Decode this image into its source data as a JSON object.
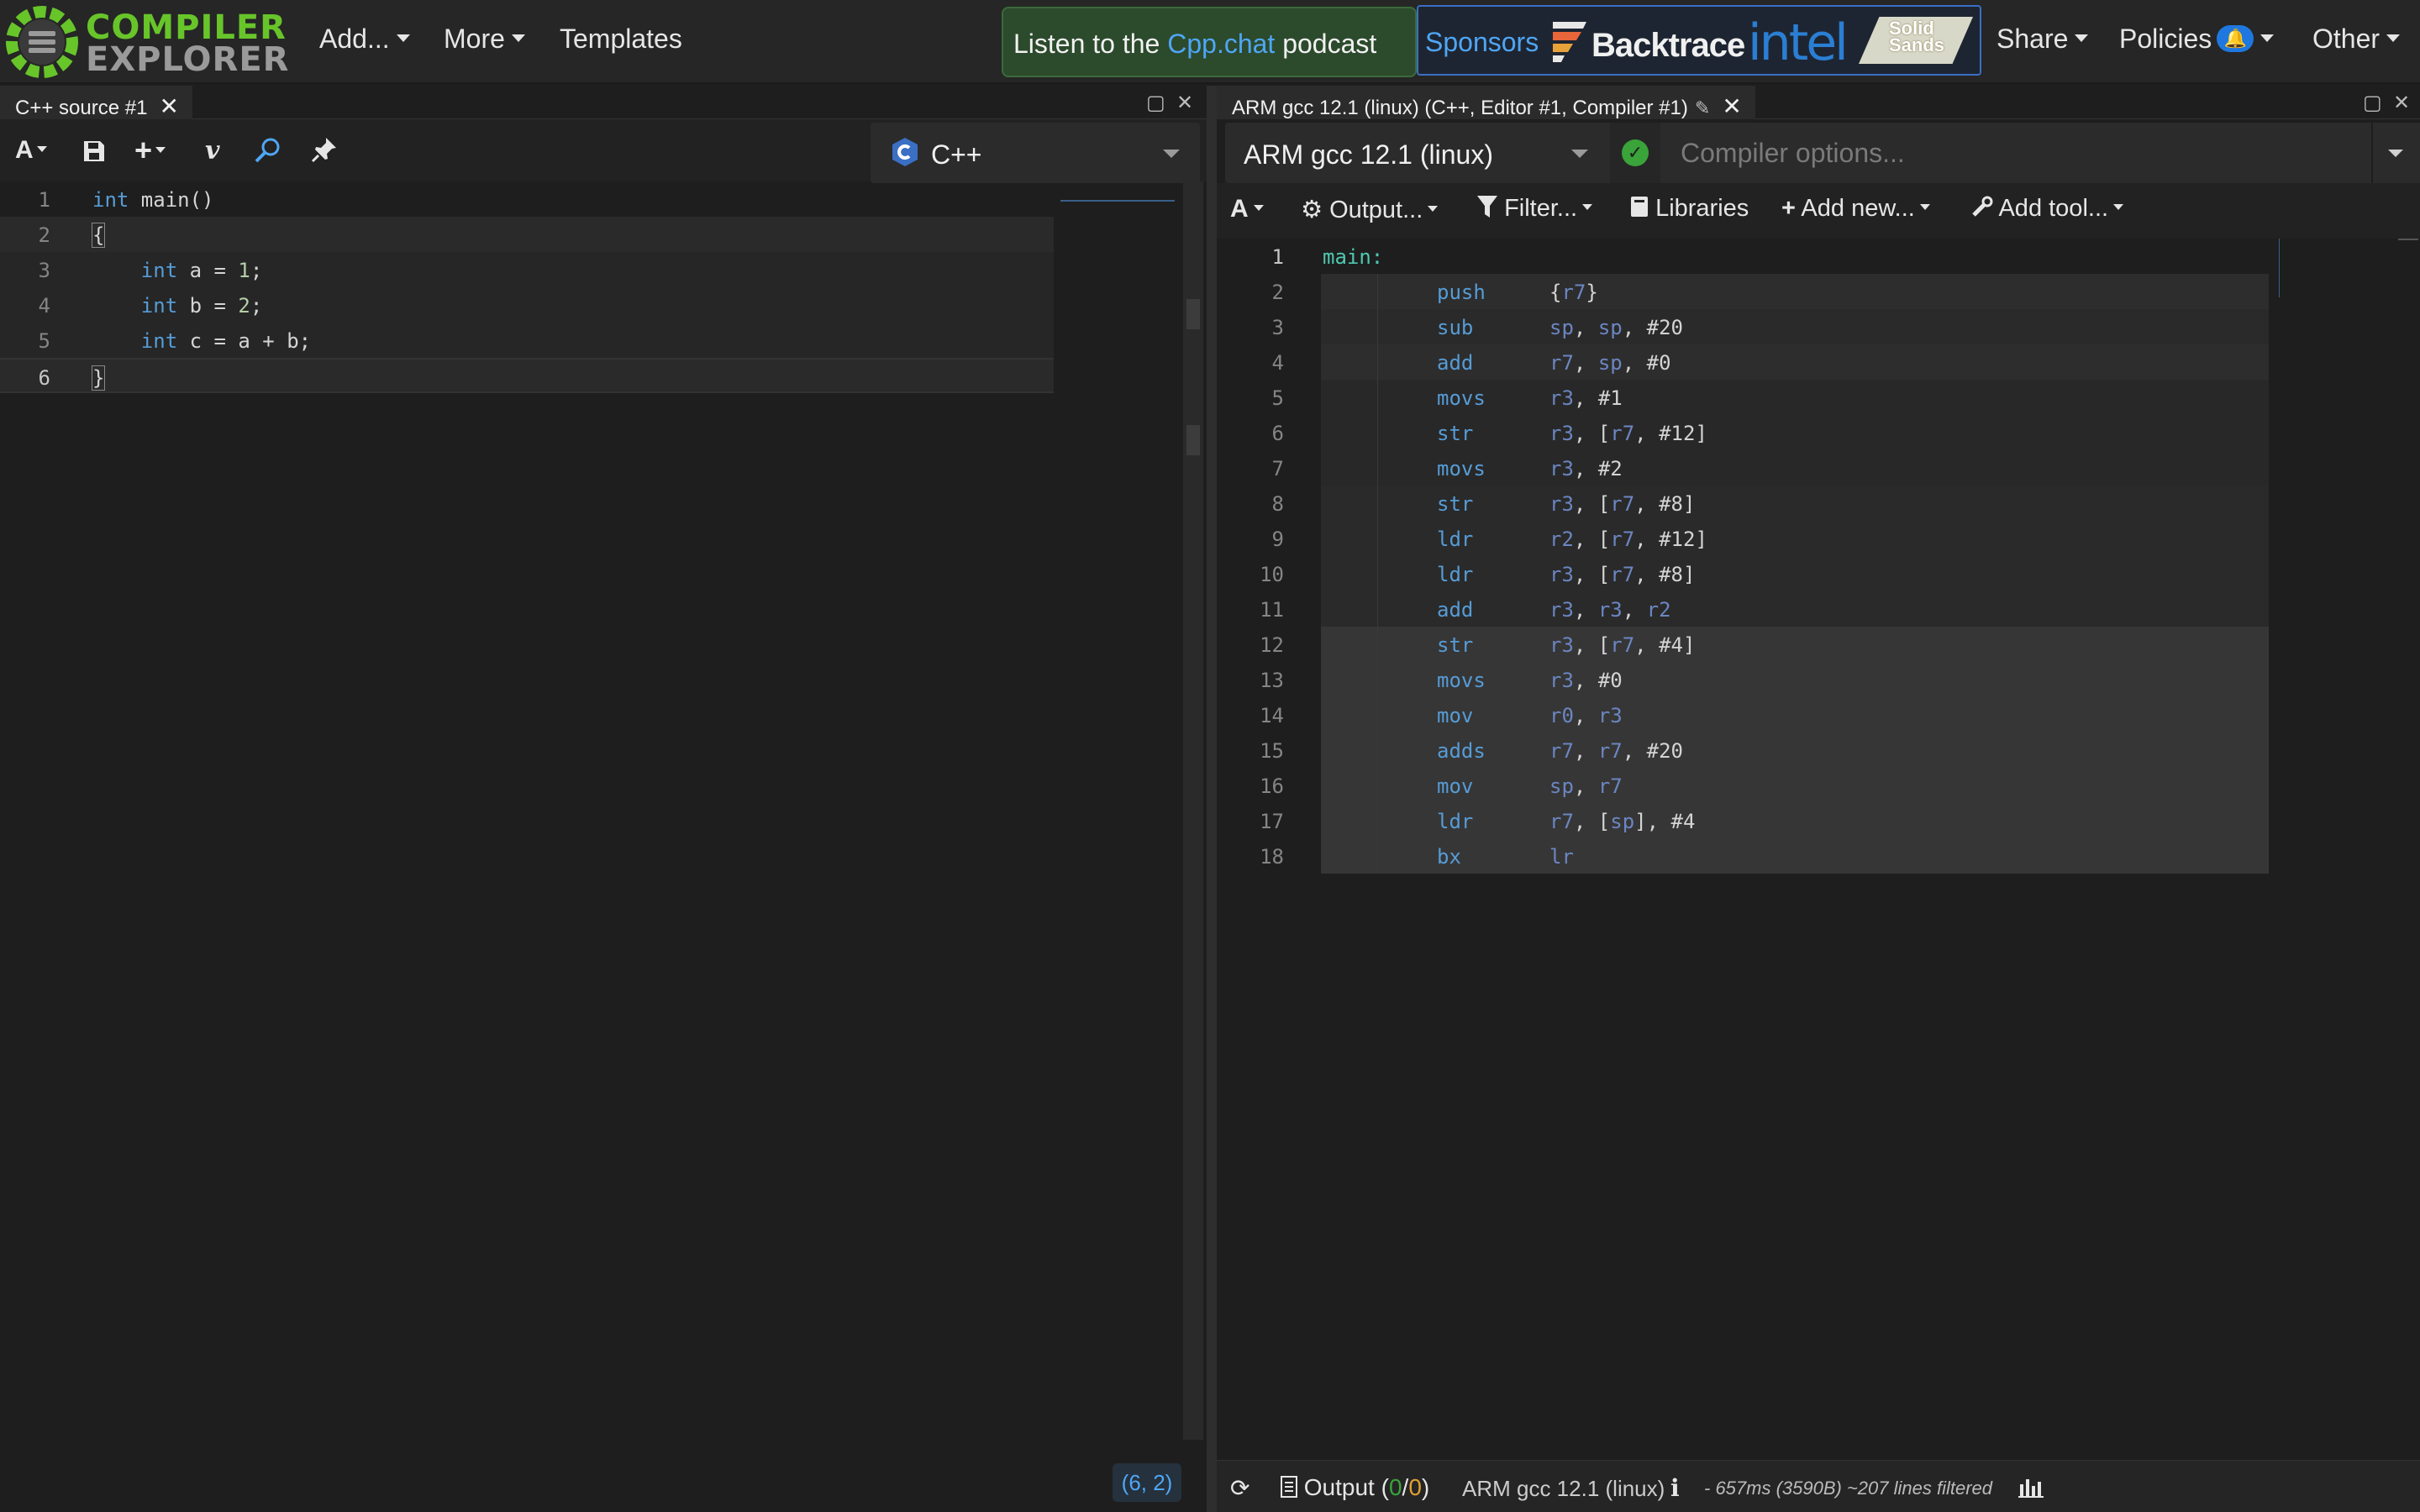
{
  "app": {
    "logo_line1": "COMPILER",
    "logo_line2": "EXPLORER"
  },
  "nav": {
    "add_label": "Add...",
    "more_label": "More",
    "templates_label": "Templates",
    "podcast_prefix": "Listen to the ",
    "podcast_link": "Cpp.chat",
    "podcast_suffix": " podcast",
    "sponsors_label": "Sponsors",
    "sponsor_1": "Backtrace",
    "sponsor_2": "intel",
    "sponsor_3_line1": "Solid",
    "sponsor_3_line2": "Sands",
    "share_label": "Share",
    "policies_label": "Policies",
    "other_label": "Other"
  },
  "source_pane": {
    "tab_title": "C++ source #1",
    "language": "C++",
    "cursor_position": "(6, 2)",
    "lines": [
      {
        "n": "1",
        "indent": "",
        "kw": "int",
        "rest": " main()"
      },
      {
        "n": "2",
        "indent": "",
        "kw": "",
        "rest": "{"
      },
      {
        "n": "3",
        "indent": "    ",
        "kw": "int",
        "rest": " a = ",
        "num": "1",
        "end": ";"
      },
      {
        "n": "4",
        "indent": "    ",
        "kw": "int",
        "rest": " b = ",
        "num": "2",
        "end": ";"
      },
      {
        "n": "5",
        "indent": "    ",
        "kw": "int",
        "rest": " c = a + b;"
      },
      {
        "n": "6",
        "indent": "",
        "kw": "",
        "rest": "}"
      }
    ]
  },
  "compiler_pane": {
    "tab_title": "ARM gcc 12.1 (linux) (C++, Editor #1, Compiler #1)",
    "compiler": "ARM gcc 12.1 (linux)",
    "options_placeholder": "Compiler options...",
    "toolbar": {
      "output": "Output...",
      "filter": "Filter...",
      "libraries": "Libraries",
      "add_new": "Add new...",
      "add_tool": "Add tool..."
    },
    "label": "main:",
    "asm": [
      {
        "n": "2",
        "op": "push",
        "args": [
          [
            "p",
            "{"
          ],
          [
            "r",
            "r7"
          ],
          [
            "p",
            "}"
          ]
        ]
      },
      {
        "n": "3",
        "op": "sub",
        "args": [
          [
            "r",
            "sp"
          ],
          [
            "p",
            ", "
          ],
          [
            "r",
            "sp"
          ],
          [
            "p",
            ", "
          ],
          [
            "i",
            "#20"
          ]
        ]
      },
      {
        "n": "4",
        "op": "add",
        "args": [
          [
            "r",
            "r7"
          ],
          [
            "p",
            ", "
          ],
          [
            "r",
            "sp"
          ],
          [
            "p",
            ", "
          ],
          [
            "i",
            "#0"
          ]
        ]
      },
      {
        "n": "5",
        "op": "movs",
        "args": [
          [
            "r",
            "r3"
          ],
          [
            "p",
            ", "
          ],
          [
            "i",
            "#1"
          ]
        ]
      },
      {
        "n": "6",
        "op": "str",
        "args": [
          [
            "r",
            "r3"
          ],
          [
            "p",
            ", ["
          ],
          [
            "r",
            "r7"
          ],
          [
            "p",
            ", "
          ],
          [
            "i",
            "#12"
          ],
          [
            "p",
            "]"
          ]
        ]
      },
      {
        "n": "7",
        "op": "movs",
        "args": [
          [
            "r",
            "r3"
          ],
          [
            "p",
            ", "
          ],
          [
            "i",
            "#2"
          ]
        ]
      },
      {
        "n": "8",
        "op": "str",
        "args": [
          [
            "r",
            "r3"
          ],
          [
            "p",
            ", ["
          ],
          [
            "r",
            "r7"
          ],
          [
            "p",
            ", "
          ],
          [
            "i",
            "#8"
          ],
          [
            "p",
            "]"
          ]
        ]
      },
      {
        "n": "9",
        "op": "ldr",
        "args": [
          [
            "r",
            "r2"
          ],
          [
            "p",
            ", ["
          ],
          [
            "r",
            "r7"
          ],
          [
            "p",
            ", "
          ],
          [
            "i",
            "#12"
          ],
          [
            "p",
            "]"
          ]
        ]
      },
      {
        "n": "10",
        "op": "ldr",
        "args": [
          [
            "r",
            "r3"
          ],
          [
            "p",
            ", ["
          ],
          [
            "r",
            "r7"
          ],
          [
            "p",
            ", "
          ],
          [
            "i",
            "#8"
          ],
          [
            "p",
            "]"
          ]
        ]
      },
      {
        "n": "11",
        "op": "add",
        "args": [
          [
            "r",
            "r3"
          ],
          [
            "p",
            ", "
          ],
          [
            "r",
            "r3"
          ],
          [
            "p",
            ", "
          ],
          [
            "r",
            "r2"
          ]
        ]
      },
      {
        "n": "12",
        "op": "str",
        "args": [
          [
            "r",
            "r3"
          ],
          [
            "p",
            ", ["
          ],
          [
            "r",
            "r7"
          ],
          [
            "p",
            ", "
          ],
          [
            "i",
            "#4"
          ],
          [
            "p",
            "]"
          ]
        ]
      },
      {
        "n": "13",
        "op": "movs",
        "args": [
          [
            "r",
            "r3"
          ],
          [
            "p",
            ", "
          ],
          [
            "i",
            "#0"
          ]
        ]
      },
      {
        "n": "14",
        "op": "mov",
        "args": [
          [
            "r",
            "r0"
          ],
          [
            "p",
            ", "
          ],
          [
            "r",
            "r3"
          ]
        ]
      },
      {
        "n": "15",
        "op": "adds",
        "args": [
          [
            "r",
            "r7"
          ],
          [
            "p",
            ", "
          ],
          [
            "r",
            "r7"
          ],
          [
            "p",
            ", "
          ],
          [
            "i",
            "#20"
          ]
        ]
      },
      {
        "n": "16",
        "op": "mov",
        "args": [
          [
            "r",
            "sp"
          ],
          [
            "p",
            ", "
          ],
          [
            "r",
            "r7"
          ]
        ]
      },
      {
        "n": "17",
        "op": "ldr",
        "args": [
          [
            "r",
            "r7"
          ],
          [
            "p",
            ", ["
          ],
          [
            "r",
            "sp"
          ],
          [
            "p",
            "], "
          ],
          [
            "i",
            "#4"
          ]
        ]
      },
      {
        "n": "18",
        "op": "bx",
        "args": [
          [
            "r",
            "lr"
          ]
        ]
      }
    ],
    "status": {
      "output_label": "Output (",
      "output_ok": "0",
      "output_sep": "/",
      "output_warn": "0",
      "output_close": ")",
      "compiler_name": "ARM gcc 12.1 (linux)",
      "timing": "- 657ms (3590B) ~207 lines filtered"
    }
  },
  "colors": {
    "background": "#1e1e1e",
    "brand_green": "#67c52a",
    "link_blue": "#4fa6f5",
    "keyword": "#569cd6",
    "register": "#6b86c2",
    "number": "#b5cea8",
    "label": "#4ec9b0"
  }
}
